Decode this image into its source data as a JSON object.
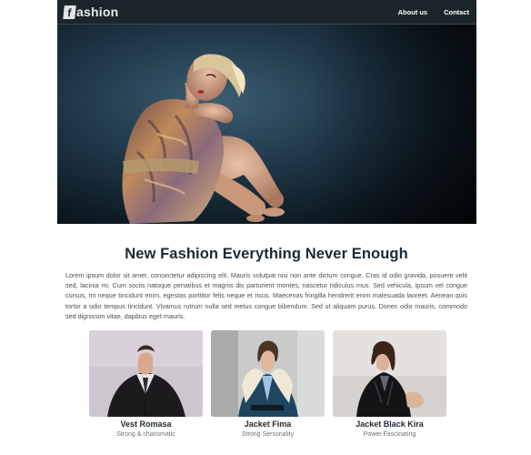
{
  "nav": {
    "logo_letter": "f",
    "logo_text": "ashion",
    "links": [
      {
        "label": "About us"
      },
      {
        "label": "Contact"
      }
    ]
  },
  "article": {
    "headline": "New Fashion Everything Never Enough",
    "body": "Lorem ipsum dolor sit amet, consectetur adipiscing elit. Mauris volutpat nisi non ante dictum congue. Cras id odio gravida, posuere velit sed, lacinia mi. Cum sociis natoque penatibus et magnis dis parturient montes, nascetur ridiculus mus. Sed vehicula, ipsum vel congue cursus, mi neque tincidunt enim, egestas porttitor felis neque et risus. Maecenas fringilla hendrerit enim malesuada laoreet. Aenean quis tortor a odio tempus tincidunt. Vivamus rutrum nulla sed metus congue bibendum. Sed ut aliquam purus. Donec odio mauris, commodo sed dignissim vitae, dapibus eget mauris."
  },
  "products": [
    {
      "name": "Vest Romasa",
      "tagline": "Strong & charismatic"
    },
    {
      "name": "Jacket Fima",
      "tagline": "Strong Sersonality"
    },
    {
      "name": "Jacket Black Kira",
      "tagline": "Power Fascinating"
    }
  ],
  "colors": {
    "nav_background": "#1b262b",
    "hero_background": "#21394a",
    "headline": "#1e2a33",
    "body_text": "#4a4f55"
  }
}
